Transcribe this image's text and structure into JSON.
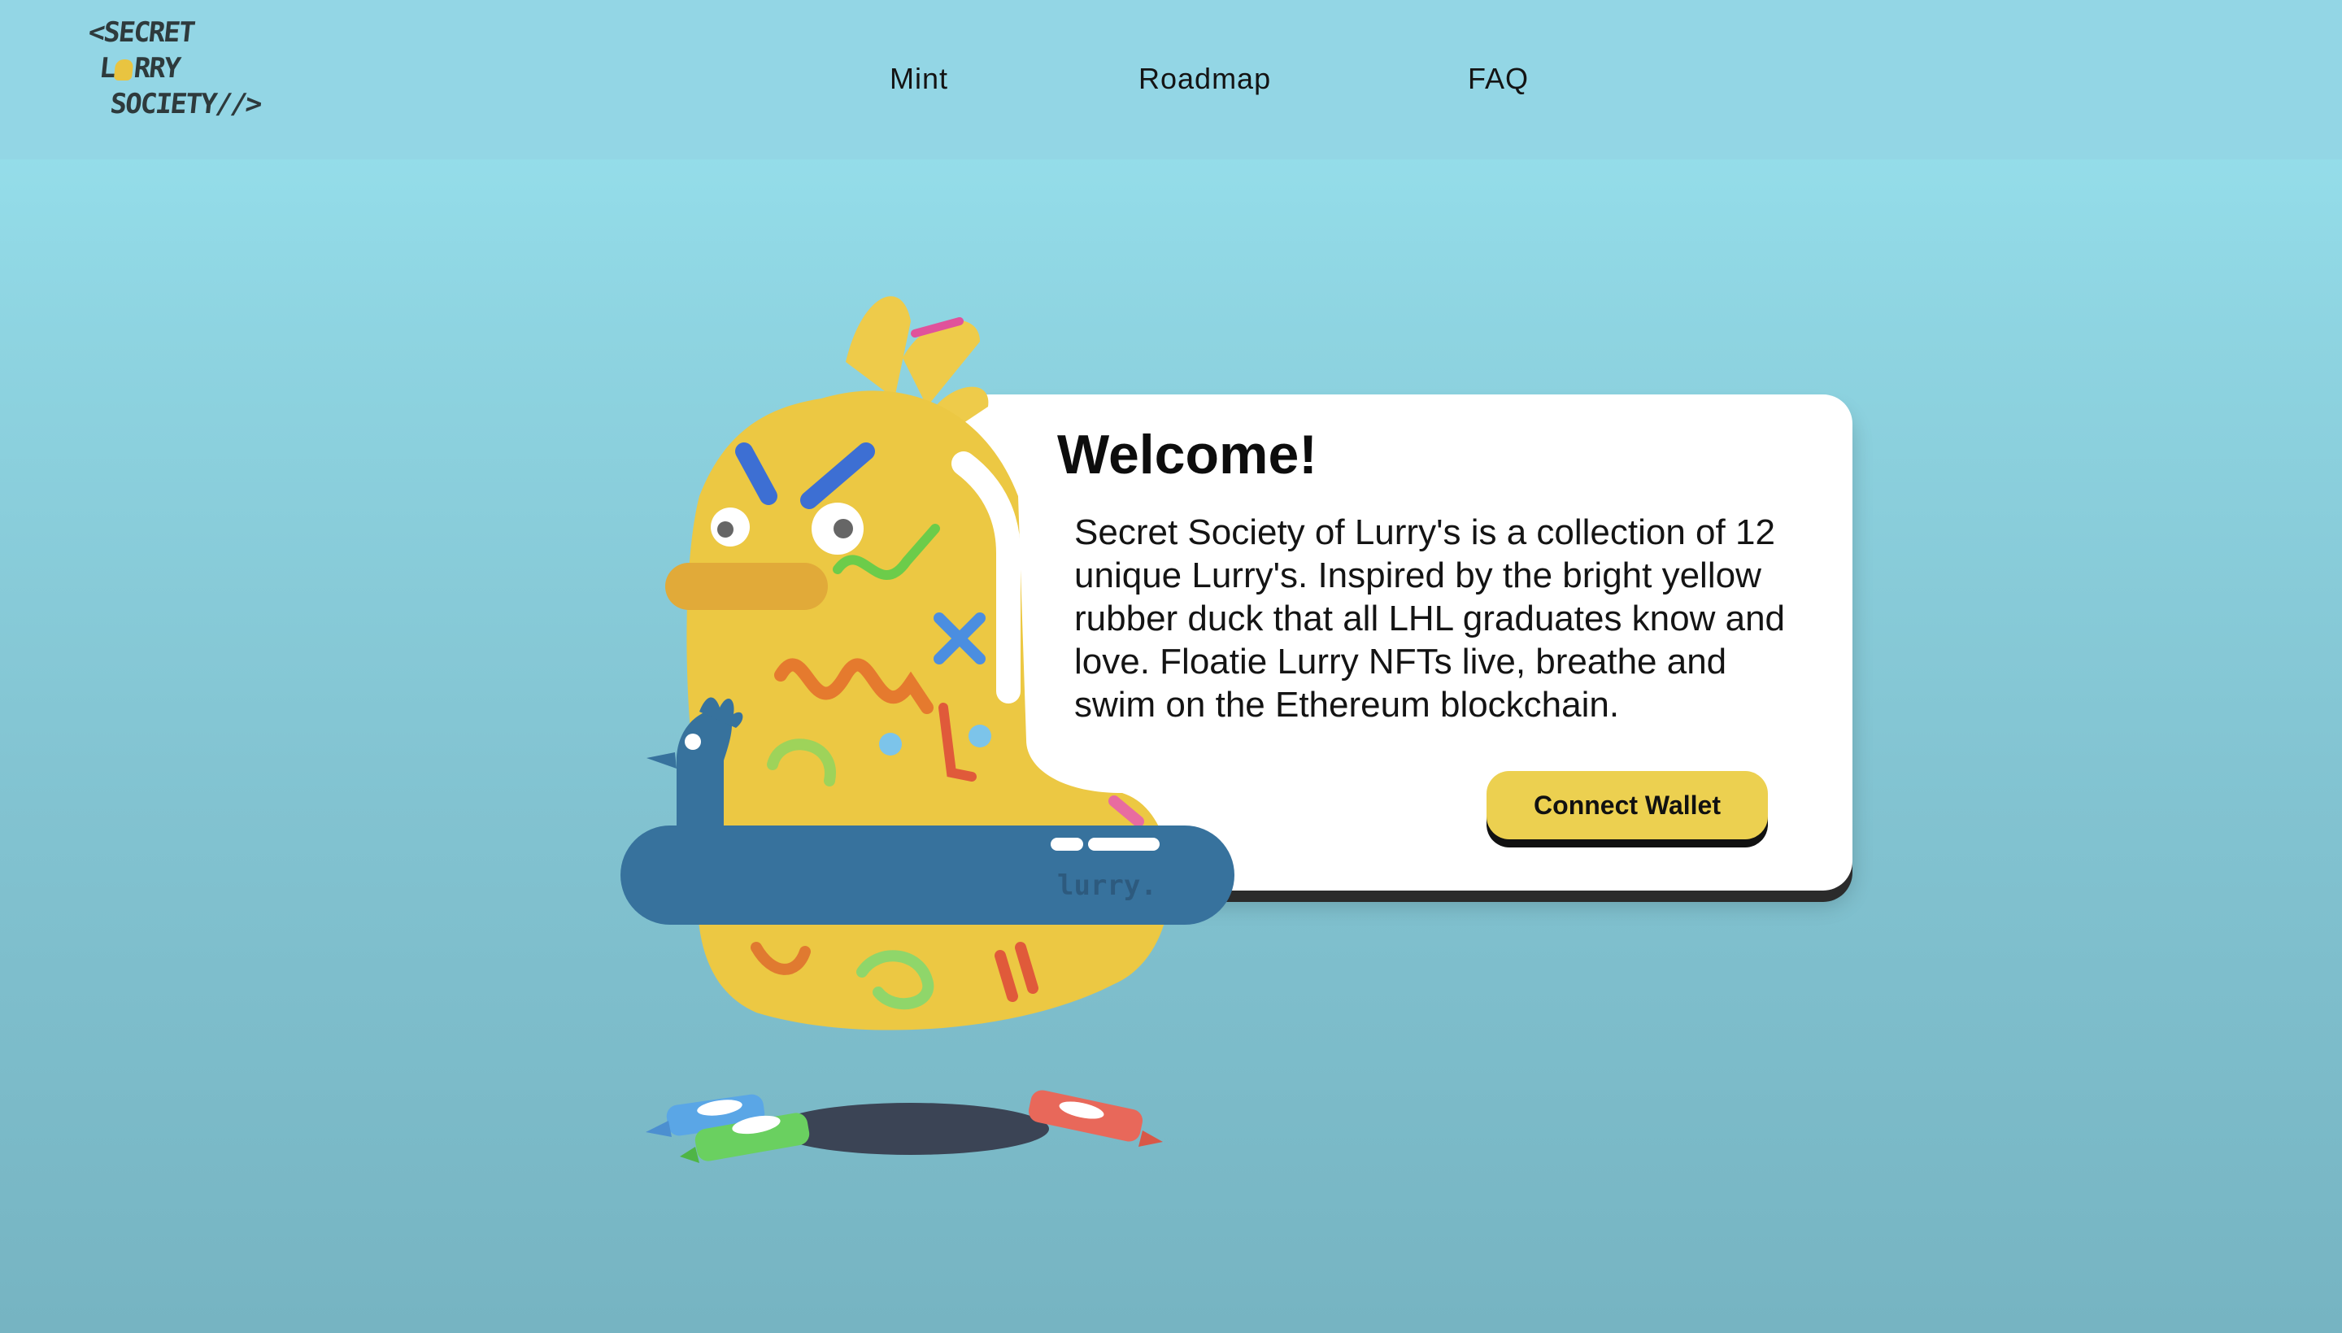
{
  "logo": {
    "line1": "<SECRET",
    "line2a": "L",
    "line2b": "RRY",
    "line3": "SOCIETY//>"
  },
  "nav": {
    "items": [
      {
        "label": "Mint"
      },
      {
        "label": "Roadmap"
      },
      {
        "label": "FAQ"
      }
    ]
  },
  "hero": {
    "title": "Welcome!",
    "description": "Secret Society of Lurry's is a collection of 12 unique Lurry's. Inspired by the bright yellow rubber duck that all LHL graduates know and love. Floatie Lurry NFTs live, breathe and swim on the Ethereum blockchain.",
    "connect_label": "Connect Wallet",
    "float_label": "lurry."
  },
  "colors": {
    "nav_bg": "#93d6e5",
    "duck_yellow": "#ecc843",
    "float_blue": "#37729d",
    "button_yellow": "#ecd050"
  }
}
